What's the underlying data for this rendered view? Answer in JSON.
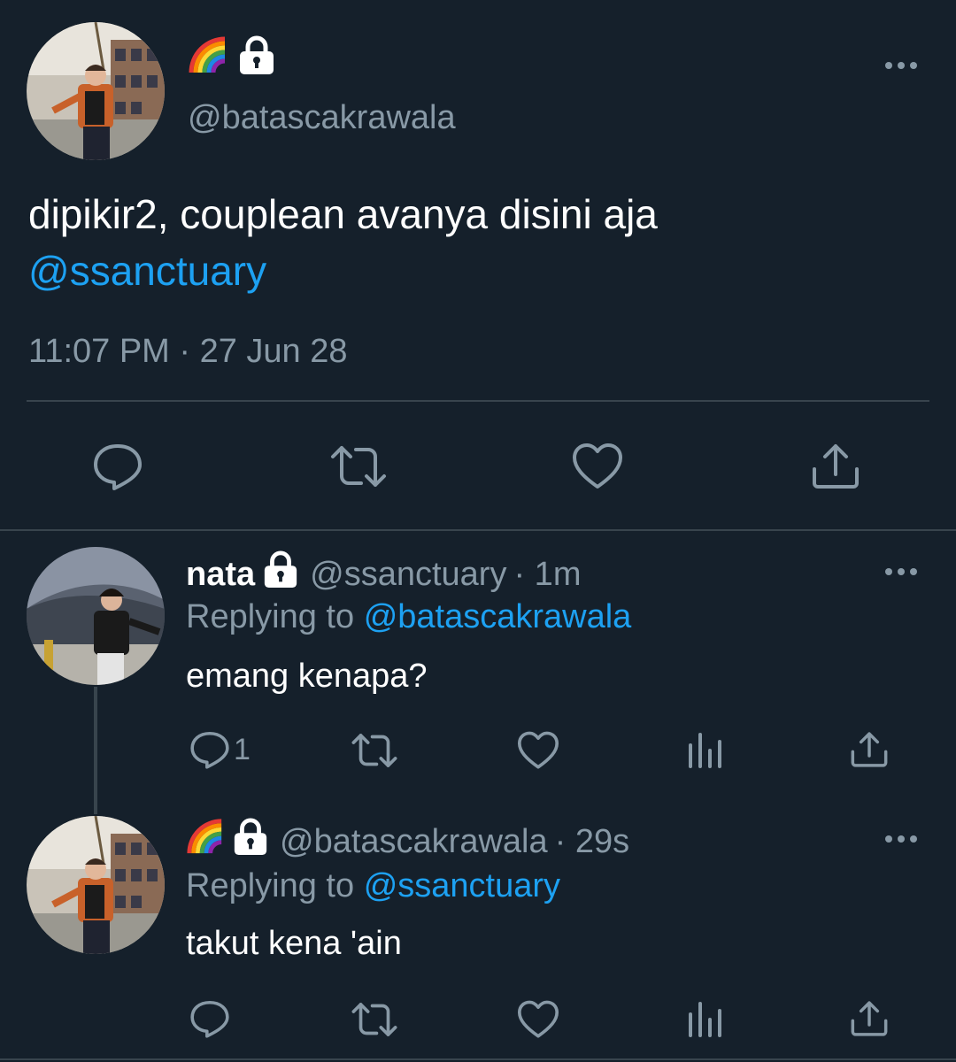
{
  "main_tweet": {
    "handle": "@batascakrawala",
    "text_before_mention": "dipikir2, couplean avanya disini aja",
    "mention": "@ssanctuary",
    "timestamp": "11:07 PM · 27 Jun 28",
    "display_name_icons": [
      "rainbow-emoji",
      "lock-icon"
    ]
  },
  "replies": [
    {
      "display_name": "nata",
      "handle": "@ssanctuary",
      "time": "· 1m",
      "replying_prefix": "Replying to",
      "replying_to": "@batascakrawala",
      "text": "emang kenapa?",
      "reply_count": "1"
    },
    {
      "display_name_icons": [
        "rainbow-emoji",
        "lock-icon"
      ],
      "handle": "@batascakrawala",
      "time": "· 29s",
      "replying_prefix": "Replying to",
      "replying_to": "@ssanctuary",
      "text": "takut kena 'ain",
      "reply_count": ""
    }
  ],
  "colors": {
    "background": "#15202b",
    "muted": "#8899a6",
    "link": "#1da1f2",
    "divider": "#38444d"
  }
}
